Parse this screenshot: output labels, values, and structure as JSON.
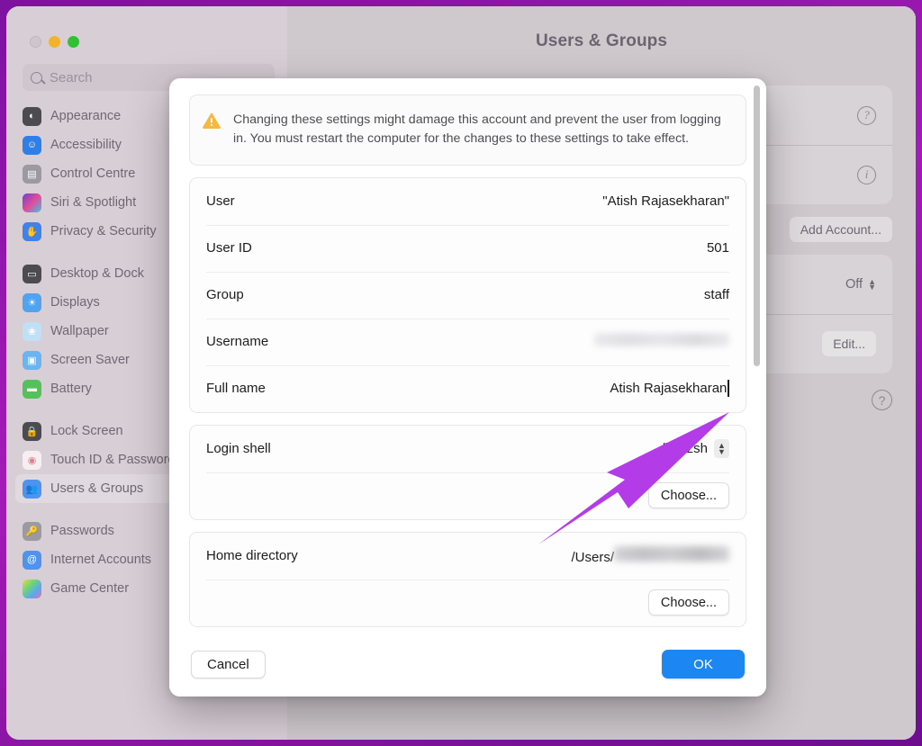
{
  "window": {
    "title": "Users & Groups",
    "traffic_lights": [
      {
        "name": "close",
        "color": "#cfc5cd",
        "enabled": false
      },
      {
        "name": "minimize",
        "color": "#f2b32c",
        "enabled": true
      },
      {
        "name": "zoom",
        "color": "#2fc231",
        "enabled": true
      }
    ]
  },
  "search": {
    "placeholder": "Search",
    "value": ""
  },
  "sidebar": {
    "groups": [
      {
        "items": [
          {
            "label": "Appearance",
            "icon": "appearance-icon",
            "selected": false
          },
          {
            "label": "Accessibility",
            "icon": "accessibility-icon",
            "selected": false
          },
          {
            "label": "Control Centre",
            "icon": "control-centre-icon",
            "selected": false
          },
          {
            "label": "Siri & Spotlight",
            "icon": "siri-spotlight-icon",
            "selected": false
          },
          {
            "label": "Privacy & Security",
            "icon": "privacy-security-icon",
            "selected": false
          }
        ]
      },
      {
        "items": [
          {
            "label": "Desktop & Dock",
            "icon": "desktop-dock-icon",
            "selected": false
          },
          {
            "label": "Displays",
            "icon": "displays-icon",
            "selected": false
          },
          {
            "label": "Wallpaper",
            "icon": "wallpaper-icon",
            "selected": false
          },
          {
            "label": "Screen Saver",
            "icon": "screen-saver-icon",
            "selected": false
          },
          {
            "label": "Battery",
            "icon": "battery-icon",
            "selected": false
          }
        ]
      },
      {
        "items": [
          {
            "label": "Lock Screen",
            "icon": "lock-screen-icon",
            "selected": false
          },
          {
            "label": "Touch ID & Password",
            "icon": "touch-id-icon",
            "selected": false
          },
          {
            "label": "Users & Groups",
            "icon": "users-groups-icon",
            "selected": true
          }
        ]
      },
      {
        "items": [
          {
            "label": "Passwords",
            "icon": "passwords-icon",
            "selected": false
          },
          {
            "label": "Internet Accounts",
            "icon": "internet-accounts-icon",
            "selected": false
          },
          {
            "label": "Game Center",
            "icon": "game-center-icon",
            "selected": false
          }
        ]
      }
    ]
  },
  "background_pane": {
    "title": "Users & Groups",
    "info_icon": "info-circle-icon",
    "add_account_label": "Add Account...",
    "automatic_login_value": "Off",
    "edit_label": "Edit...",
    "help_label": "?"
  },
  "sheet": {
    "warning": {
      "icon": "warning-triangle-icon",
      "text": "Changing these settings might damage this account and prevent the user from logging in. You must restart the computer for the changes to these settings to take effect."
    },
    "fields": [
      {
        "label": "User",
        "value": "\"Atish Rajasekharan\"",
        "type": "text"
      },
      {
        "label": "User ID",
        "value": "501",
        "type": "text"
      },
      {
        "label": "Group",
        "value": "staff",
        "type": "text"
      },
      {
        "label": "Username",
        "value": "",
        "type": "redacted"
      },
      {
        "label": "Full name",
        "value": "Atish Rajasekharan",
        "type": "editing"
      }
    ],
    "login_shell": {
      "label": "Login shell",
      "value": "/bin/zsh",
      "stepper_icon": "stepper-updown-icon",
      "choose_label": "Choose..."
    },
    "home_directory": {
      "label": "Home directory",
      "value_prefix": "/Users/",
      "value_redacted": true,
      "choose_label": "Choose..."
    },
    "scrollbar": {
      "visible": true
    },
    "footer": {
      "cancel_label": "Cancel",
      "ok_label": "OK",
      "ok_color": "#1c87f2"
    }
  },
  "annotation": {
    "arrow": {
      "name": "annotation-arrow",
      "color": "#b43ce8",
      "points_to": "Full name"
    }
  },
  "theme": {
    "frame_color": "#8c1ba8",
    "warning_color": "#f5b942",
    "accent_color": "#1c87f2"
  }
}
